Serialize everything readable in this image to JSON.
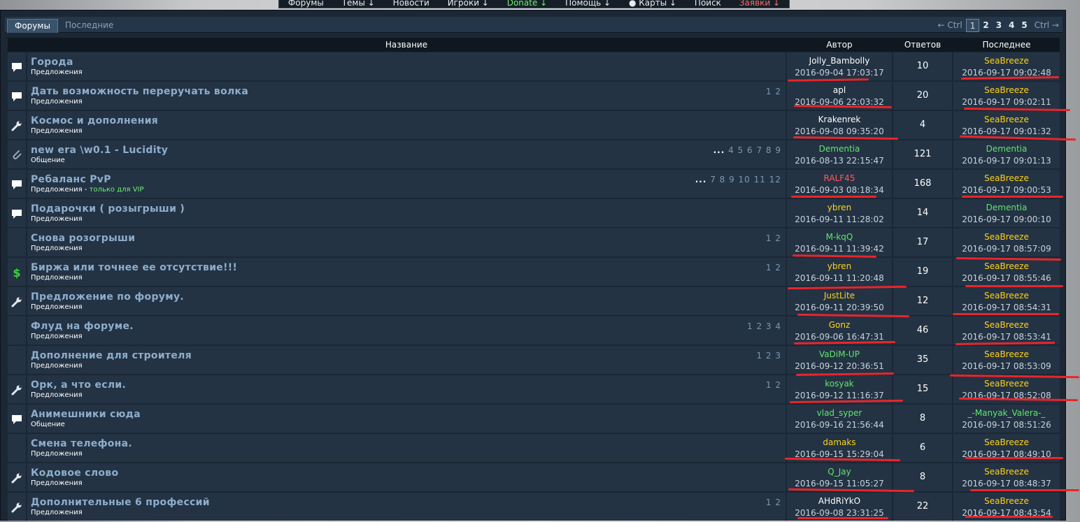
{
  "nav": [
    "Форумы",
    "Темы ↓",
    "Новости",
    "Игроки ↓",
    "Donate ↓",
    "Помощь ↓",
    "● Карты ↓",
    "Поиск",
    "Заявки ↓"
  ],
  "tabs": {
    "forums": "Форумы",
    "recent": "Последние"
  },
  "pager": {
    "prev": "← Ctrl",
    "pages": [
      "1",
      "2",
      "3",
      "4",
      "5"
    ],
    "next": "Ctrl →"
  },
  "columns": {
    "title": "Название",
    "author": "Автор",
    "replies": "Ответов",
    "last": "Последнее"
  },
  "colors": {
    "white": "#ffffff",
    "yellow": "#ffd21a",
    "green": "#62e66a",
    "red": "#ff5a5a",
    "annotation": "#e8262b"
  },
  "rows": [
    {
      "icon": "speech-bubble-icon",
      "title": "Города",
      "category": "Предложения",
      "pages": "",
      "author": "Jolly_Bambolly",
      "author_color": "white",
      "date": "2016-09-04 17:03:17",
      "replies": "10",
      "last_author": "SeaBreeze",
      "last_color": "yellow",
      "last_date": "2016-09-17 09:02:48"
    },
    {
      "icon": "speech-bubble-icon",
      "title": "Дать возможность переручать волка",
      "category": "Предложения",
      "pages": "1 2",
      "author": "apl",
      "author_color": "white",
      "date": "2016-09-06 22:03:32",
      "replies": "20",
      "last_author": "SeaBreeze",
      "last_color": "yellow",
      "last_date": "2016-09-17 09:02:11"
    },
    {
      "icon": "wrench-icon",
      "title": "Космос и дополнения",
      "category": "Предложения",
      "pages": "",
      "author": "Krakenrek",
      "author_color": "white",
      "date": "2016-09-08 09:35:20",
      "replies": "4",
      "last_author": "SeaBreeze",
      "last_color": "yellow",
      "last_date": "2016-09-17 09:01:32"
    },
    {
      "icon": "paperclip-icon",
      "title": "new era \\w0.1 - Lucidity",
      "category": "Общение",
      "pages_dots": "...",
      "pages": "4 5 6 7 8 9",
      "author": "Dementia",
      "author_color": "green",
      "date": "2016-08-13 22:15:47",
      "replies": "121",
      "last_author": "Dementia",
      "last_color": "green",
      "last_date": "2016-09-17 09:01:13"
    },
    {
      "icon": "speech-bubble-icon",
      "title": "Ребаланс PvP",
      "category": "Предложения",
      "vip": "только для VIP",
      "pages_dots": "...",
      "pages": "7 8 9 10 11 12",
      "author": "RALF45",
      "author_color": "red",
      "date": "2016-09-03 08:18:34",
      "replies": "168",
      "last_author": "SeaBreeze",
      "last_color": "yellow",
      "last_date": "2016-09-17 09:00:53"
    },
    {
      "icon": "speech-bubble-icon",
      "title": "Подарочки ( розыгрыши )",
      "category": "Предложения",
      "pages": "",
      "author": "ybren",
      "author_color": "yellow",
      "date": "2016-09-11 11:28:02",
      "replies": "14",
      "last_author": "Dementia",
      "last_color": "green",
      "last_date": "2016-09-17 09:00:10"
    },
    {
      "icon": "",
      "title": "Снова розогрыши",
      "category": "Предложения",
      "pages": "1 2",
      "author": "M-kqQ",
      "author_color": "green",
      "date": "2016-09-11 11:39:42",
      "replies": "17",
      "last_author": "SeaBreeze",
      "last_color": "yellow",
      "last_date": "2016-09-17 08:57:09"
    },
    {
      "icon": "dollar-icon",
      "title": "Биржа или точнее ее отсутствие!!!",
      "category": "Предложения",
      "pages": "1 2",
      "author": "ybren",
      "author_color": "yellow",
      "date": "2016-09-11 11:20:48",
      "replies": "19",
      "last_author": "SeaBreeze",
      "last_color": "yellow",
      "last_date": "2016-09-17 08:55:46"
    },
    {
      "icon": "wrench-icon",
      "title": "Предложение по форуму.",
      "category": "Предложения",
      "pages": "",
      "author": "JustLite",
      "author_color": "yellow",
      "date": "2016-09-11 20:39:50",
      "replies": "12",
      "last_author": "SeaBreeze",
      "last_color": "yellow",
      "last_date": "2016-09-17 08:54:31"
    },
    {
      "icon": "",
      "title": "Флуд на форуме.",
      "category": "Предложения",
      "pages": "1 2 3 4",
      "author": "Gonz",
      "author_color": "yellow",
      "date": "2016-09-06 16:47:31",
      "replies": "46",
      "last_author": "SeaBreeze",
      "last_color": "yellow",
      "last_date": "2016-09-17 08:53:41"
    },
    {
      "icon": "",
      "title": "Дополнение для строителя",
      "category": "Предложения",
      "pages": "1 2 3",
      "author": "VaDiM-UP",
      "author_color": "green",
      "date": "2016-09-12 20:36:51",
      "replies": "35",
      "last_author": "SeaBreeze",
      "last_color": "yellow",
      "last_date": "2016-09-17 08:53:09"
    },
    {
      "icon": "wrench-icon",
      "title": "Орк, а что если.",
      "category": "Предложения",
      "pages": "1 2",
      "author": "kosyak",
      "author_color": "green",
      "date": "2016-09-12 11:16:37",
      "replies": "15",
      "last_author": "SeaBreeze",
      "last_color": "yellow",
      "last_date": "2016-09-17 08:52:08"
    },
    {
      "icon": "speech-bubble-icon",
      "title": "Анимешники сюда",
      "category": "Общение",
      "pages": "",
      "author": "vlad_syper",
      "author_color": "green",
      "date": "2016-09-16 21:56:44",
      "replies": "8",
      "last_author": "_-Manyak_Valera-_",
      "last_color": "green",
      "last_date": "2016-09-17 08:51:26"
    },
    {
      "icon": "",
      "title": "Смена телефона.",
      "category": "Предложения",
      "pages": "",
      "author": "damaks",
      "author_color": "yellow",
      "date": "2016-09-15 15:29:04",
      "replies": "6",
      "last_author": "SeaBreeze",
      "last_color": "yellow",
      "last_date": "2016-09-17 08:49:10"
    },
    {
      "icon": "wrench-icon",
      "title": "Кодовое слово",
      "category": "Предложения",
      "pages": "",
      "author": "Q_Jay",
      "author_color": "green",
      "date": "2016-09-15 11:05:27",
      "replies": "8",
      "last_author": "SeaBreeze",
      "last_color": "yellow",
      "last_date": "2016-09-17 08:48:37"
    },
    {
      "icon": "wrench-icon",
      "title": "Дополнительные 6 профессий",
      "category": "Предложения",
      "pages": "1 2",
      "author": "AHdRiYkO",
      "author_color": "white",
      "date": "2016-09-08 23:31:25",
      "replies": "22",
      "last_author": "SeaBreeze",
      "last_color": "yellow",
      "last_date": "2016-09-17 08:43:54"
    }
  ]
}
